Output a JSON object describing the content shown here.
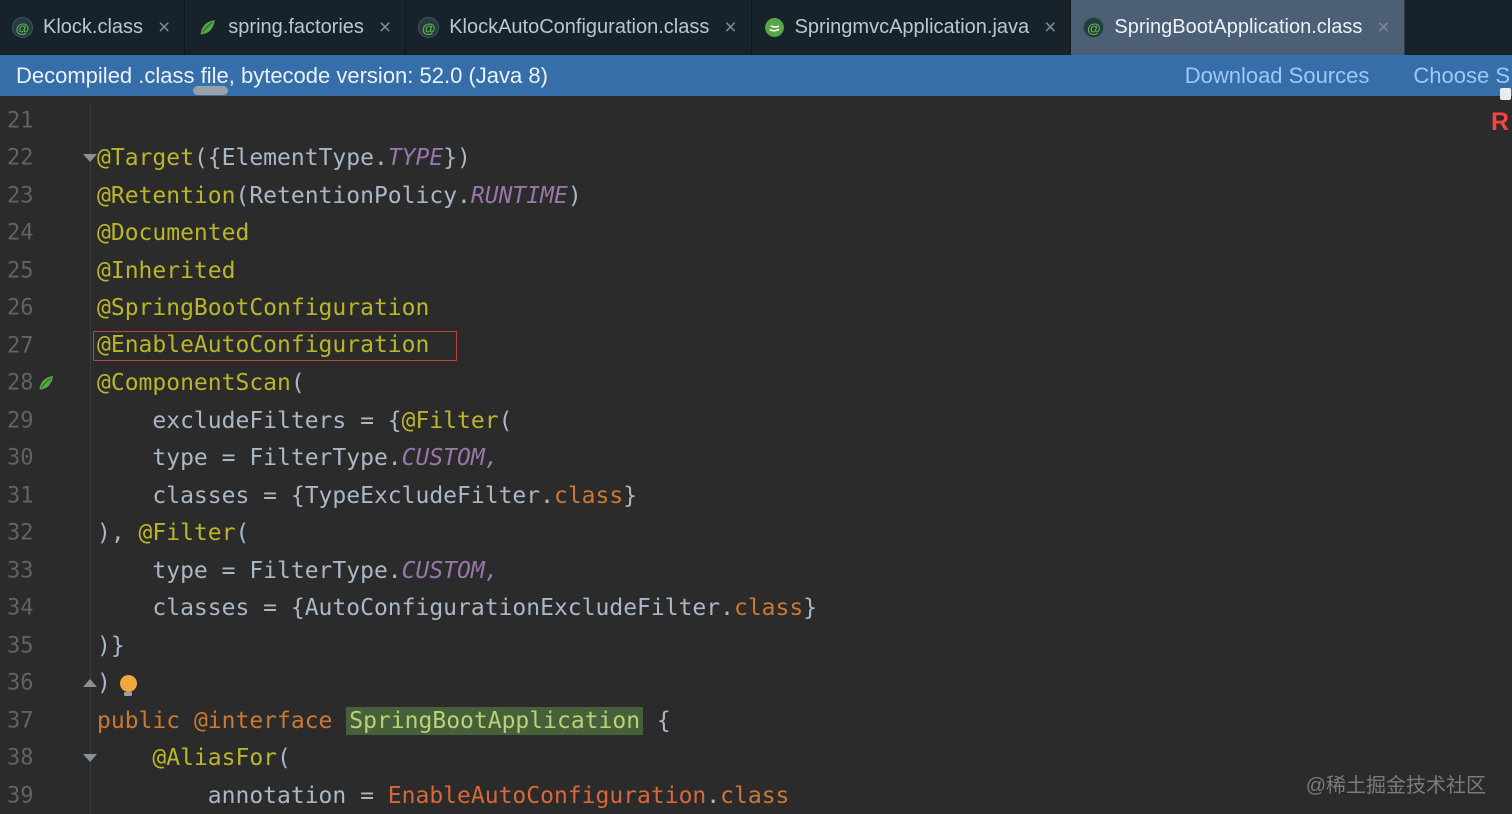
{
  "tabbar": {
    "close_glyph": "×",
    "tabs": [
      {
        "label": "Klock.class",
        "icon": "annotation-class-icon",
        "active": false
      },
      {
        "label": "spring.factories",
        "icon": "spring-leaf-icon",
        "active": false
      },
      {
        "label": "KlockAutoConfiguration.class",
        "icon": "annotation-class-icon",
        "active": false
      },
      {
        "label": "SpringmvcApplication.java",
        "icon": "spring-boot-icon",
        "active": false
      },
      {
        "label": "SpringBootApplication.class",
        "icon": "annotation-class-icon",
        "active": true
      }
    ]
  },
  "banner": {
    "message": "Decompiled .class file, bytecode version: 52.0 (Java 8)",
    "actions": [
      {
        "label": "Download Sources"
      },
      {
        "label": "Choose S"
      }
    ]
  },
  "editor": {
    "colors": {
      "editor_bg": "#2B2B2B",
      "annotation": "#BBB529",
      "keyword": "#CC7832",
      "constant": "#9876AA",
      "default_text": "#A9B7C6",
      "reference": "#D7683A",
      "line_number": "#606366",
      "highlight_bg": "#46603A",
      "highlight_text": "#BBD077",
      "error_box": "#C0443A",
      "banner_bg": "#356EA9",
      "tabbar_bg": "#18222B",
      "active_tab_bg": "#4C5F75"
    },
    "lines": [
      {
        "num": 21,
        "seg": []
      },
      {
        "num": 22,
        "fold": "down",
        "seg": [
          {
            "t": "@Target",
            "c": "ann"
          },
          {
            "t": "({",
            "c": "def"
          },
          {
            "t": "ElementType.",
            "c": "def"
          },
          {
            "t": "TYPE",
            "c": "const"
          },
          {
            "t": "})",
            "c": "def"
          }
        ]
      },
      {
        "num": 23,
        "seg": [
          {
            "t": "@Retention",
            "c": "ann"
          },
          {
            "t": "(RetentionPolicy.",
            "c": "def"
          },
          {
            "t": "RUNTIME",
            "c": "const"
          },
          {
            "t": ")",
            "c": "def"
          }
        ]
      },
      {
        "num": 24,
        "seg": [
          {
            "t": "@Documented",
            "c": "ann"
          }
        ]
      },
      {
        "num": 25,
        "seg": [
          {
            "t": "@Inherited",
            "c": "ann"
          }
        ]
      },
      {
        "num": 26,
        "seg": [
          {
            "t": "@SpringBootConfiguration",
            "c": "ann"
          }
        ]
      },
      {
        "num": 27,
        "box": true,
        "seg": [
          {
            "t": "@EnableAutoConfiguration",
            "c": "ann"
          }
        ]
      },
      {
        "num": 28,
        "icon": "spring-leaf",
        "seg": [
          {
            "t": "@ComponentScan",
            "c": "ann"
          },
          {
            "t": "(",
            "c": "def"
          }
        ]
      },
      {
        "num": 29,
        "seg": [
          {
            "t": "    excludeFilters = {",
            "c": "def"
          },
          {
            "t": "@Filter",
            "c": "ann"
          },
          {
            "t": "(",
            "c": "def"
          }
        ]
      },
      {
        "num": 30,
        "seg": [
          {
            "t": "    type = FilterType.",
            "c": "def"
          },
          {
            "t": "CUSTOM,",
            "c": "const"
          }
        ]
      },
      {
        "num": 31,
        "seg": [
          {
            "t": "    classes = {TypeExcludeFilter.",
            "c": "def"
          },
          {
            "t": "class",
            "c": "kw"
          },
          {
            "t": "}",
            "c": "def"
          }
        ]
      },
      {
        "num": 32,
        "seg": [
          {
            "t": "), ",
            "c": "def"
          },
          {
            "t": "@Filter",
            "c": "ann"
          },
          {
            "t": "(",
            "c": "def"
          }
        ]
      },
      {
        "num": 33,
        "seg": [
          {
            "t": "    type = FilterType.",
            "c": "def"
          },
          {
            "t": "CUSTOM,",
            "c": "const"
          }
        ]
      },
      {
        "num": 34,
        "seg": [
          {
            "t": "    classes = {AutoConfigurationExcludeFilter.",
            "c": "def"
          },
          {
            "t": "class",
            "c": "kw"
          },
          {
            "t": "}",
            "c": "def"
          }
        ]
      },
      {
        "num": 35,
        "seg": [
          {
            "t": ")}",
            "c": "def"
          }
        ]
      },
      {
        "num": 36,
        "fold": "up",
        "bulb": true,
        "seg": [
          {
            "t": ")",
            "c": "def"
          }
        ]
      },
      {
        "num": 37,
        "seg": [
          {
            "t": "public ",
            "c": "kw"
          },
          {
            "t": "@interface ",
            "c": "kw"
          },
          {
            "t": "SpringBootApplication",
            "c": "hl"
          },
          {
            "t": " {",
            "c": "def"
          }
        ]
      },
      {
        "num": 38,
        "fold": "down",
        "seg": [
          {
            "t": "    ",
            "c": "def"
          },
          {
            "t": "@AliasFor",
            "c": "ann"
          },
          {
            "t": "(",
            "c": "def"
          }
        ]
      },
      {
        "num": 39,
        "seg": [
          {
            "t": "        annotation = ",
            "c": "def"
          },
          {
            "t": "EnableAutoConfiguration",
            "c": "ref"
          },
          {
            "t": ".",
            "c": "def"
          },
          {
            "t": "class",
            "c": "kw"
          }
        ]
      }
    ]
  },
  "overlays": {
    "top_right_partial": "R",
    "watermark": "@稀土掘金技术社区"
  }
}
